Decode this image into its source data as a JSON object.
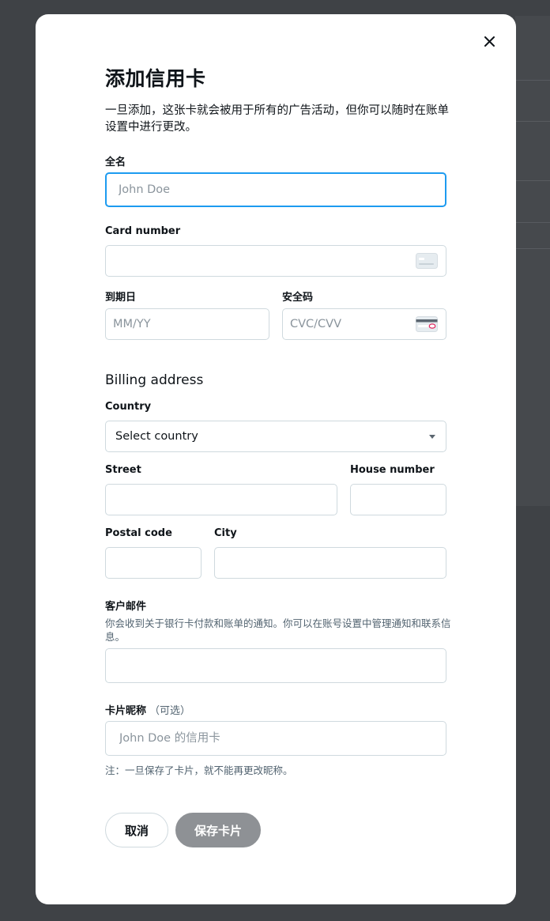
{
  "modal": {
    "title": "添加信用卡",
    "description": "一旦添加，这张卡就会被用于所有的广告活动，但你可以随时在账单设置中进行更改。"
  },
  "fields": {
    "full_name": {
      "label": "全名",
      "placeholder": "John Doe",
      "value": ""
    },
    "card_number": {
      "label": "Card number",
      "value": ""
    },
    "expiry": {
      "label": "到期日",
      "placeholder": "MM/YY"
    },
    "security_code": {
      "label": "安全码",
      "placeholder": "CVC/CVV"
    }
  },
  "billing": {
    "title": "Billing address",
    "country": {
      "label": "Country",
      "selected": "Select country"
    },
    "street": {
      "label": "Street"
    },
    "house_number": {
      "label": "House number"
    },
    "postal_code": {
      "label": "Postal code"
    },
    "city": {
      "label": "City"
    }
  },
  "email": {
    "label": "客户邮件",
    "description": "你会收到关于银行卡付款和账单的通知。你可以在账号设置中管理通知和联系信息。"
  },
  "nickname": {
    "label": "卡片昵称",
    "optional": "（可选）",
    "placeholder": "John Doe 的信用卡",
    "note": "注：一旦保存了卡片，就不能再更改昵称。"
  },
  "buttons": {
    "cancel": "取消",
    "save": "保存卡片"
  },
  "colors": {
    "focus": "#1d9bf0",
    "save_disabled": "#8e9195",
    "backdrop": "#3f4246"
  }
}
